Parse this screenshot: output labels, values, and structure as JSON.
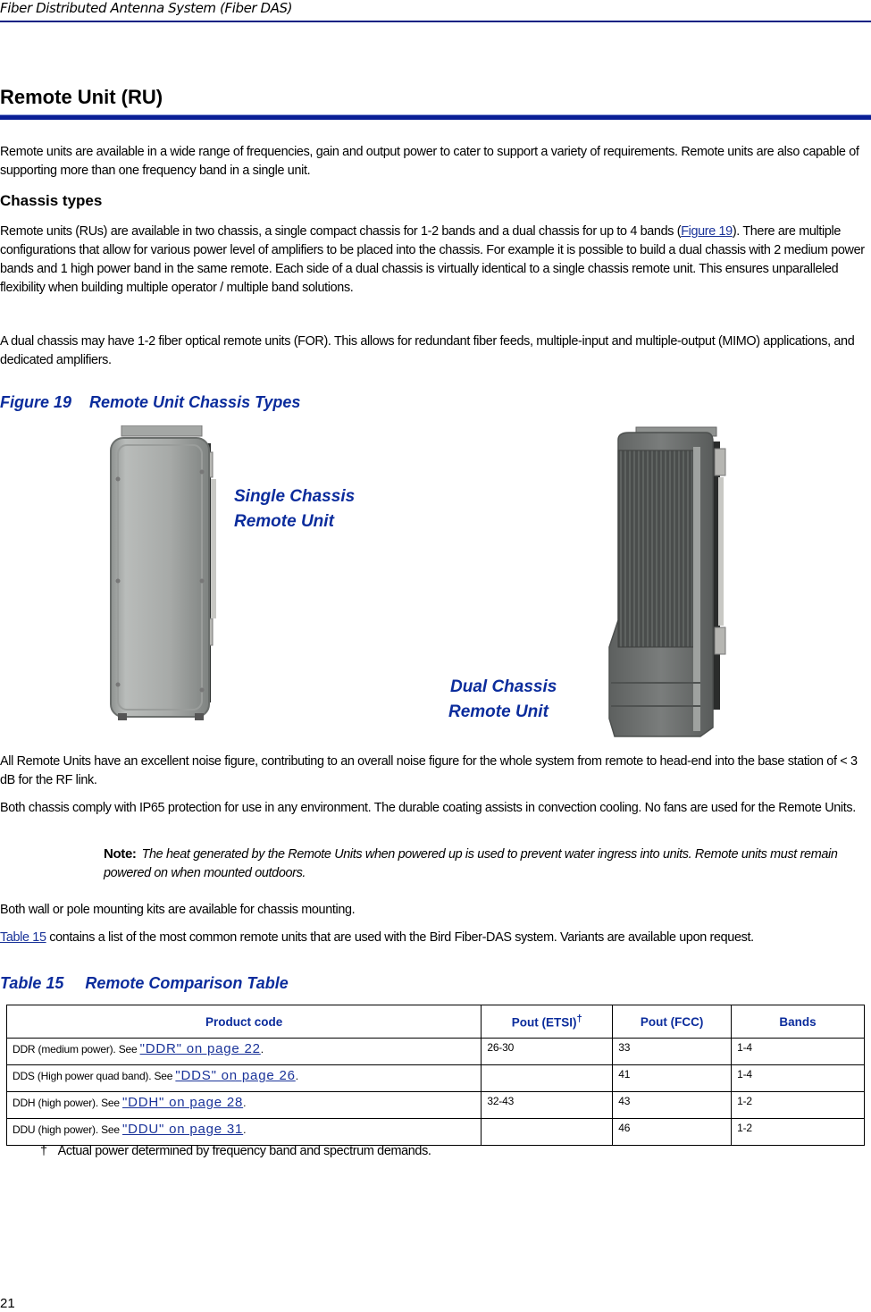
{
  "running_header": "Fiber Distributed Antenna System (Fiber DAS)",
  "section_title": "Remote Unit (RU)",
  "intro_paragraph": "Remote units are available in a wide range of frequencies, gain and output power to cater to support a variety of requirements. Remote units are also capable of supporting more than one frequency band in a single unit.",
  "chassis_section": {
    "heading": "Chassis types",
    "paragraph1": {
      "before_link": "Remote units (RUs) are available in two chassis, a single compact chassis for 1-2 bands and a dual chassis for up to 4 bands (",
      "link_text": "Figure 19",
      "after_link": "). There are multiple configurations that allow for various power level of amplifiers to be placed into the chassis. For example it is possible to build a dual chassis with 2 medium power bands and 1 high power band in the same remote. Each side of a dual chassis is virtually identical to a single chassis remote unit. This ensures unparalleled flexibility when building multiple operator / multiple band solutions."
    },
    "paragraph2": "A dual chassis may have 1-2 fiber optical remote units (FOR). This allows for redundant fiber feeds, multiple-input and multiple-output (MIMO) applications, and dedicated amplifiers."
  },
  "figure": {
    "number": "Figure 19",
    "title": "Remote Unit Chassis Types",
    "single_label_line1": "Single Chassis",
    "single_label_line2": "Remote Unit",
    "dual_label_line1": "Dual Chassis",
    "dual_label_line2": "Remote Unit"
  },
  "noise_paragraph": "All Remote Units have an excellent noise figure, contributing to an overall noise figure for the whole system from remote to head-end into the base station of < 3 dB for the RF link.",
  "ip65_paragraph": "Both chassis comply with IP65 protection for use in any environment. The durable coating assists in convection cooling. No fans are used for the Remote Units.",
  "note": {
    "label": "Note:",
    "body": "The heat generated by the Remote Units when powered up is used to prevent water ingress into units. Remote units must remain powered on when mounted outdoors."
  },
  "mounting_paragraph": "Both wall or pole mounting kits are available for chassis mounting.",
  "table_intro": {
    "link_text": "Table 15",
    "after_link": " contains a list of the most common remote units that are used with the Bird Fiber-DAS system. Variants are available upon request."
  },
  "table": {
    "number": "Table 15",
    "title": "Remote Comparison Table",
    "headers": [
      "Product code",
      "Pout (ETSI)",
      "Pout (FCC)",
      "Bands"
    ],
    "etsi_footnote_mark": "†",
    "rows": [
      {
        "desc": "DDR (medium power). See ",
        "link": "\"DDR\" on page 22",
        "etsi": "26-30",
        "fcc": "33",
        "bands": "1-4"
      },
      {
        "desc": "DDS (High power quad band). See ",
        "link": "\"DDS\" on page 26",
        "etsi": "",
        "fcc": "41",
        "bands": "1-4"
      },
      {
        "desc": "DDH (high power). See ",
        "link": "\"DDH\" on page 28",
        "etsi": "32-43",
        "fcc": "43",
        "bands": "1-2"
      },
      {
        "desc": "DDU (high power). See ",
        "link": "\"DDU\" on page 31",
        "etsi": "",
        "fcc": "46",
        "bands": "1-2"
      }
    ],
    "period": "."
  },
  "footnote": {
    "mark": "†",
    "text": "Actual power determined by frequency band and spectrum demands."
  },
  "page_number": "21"
}
